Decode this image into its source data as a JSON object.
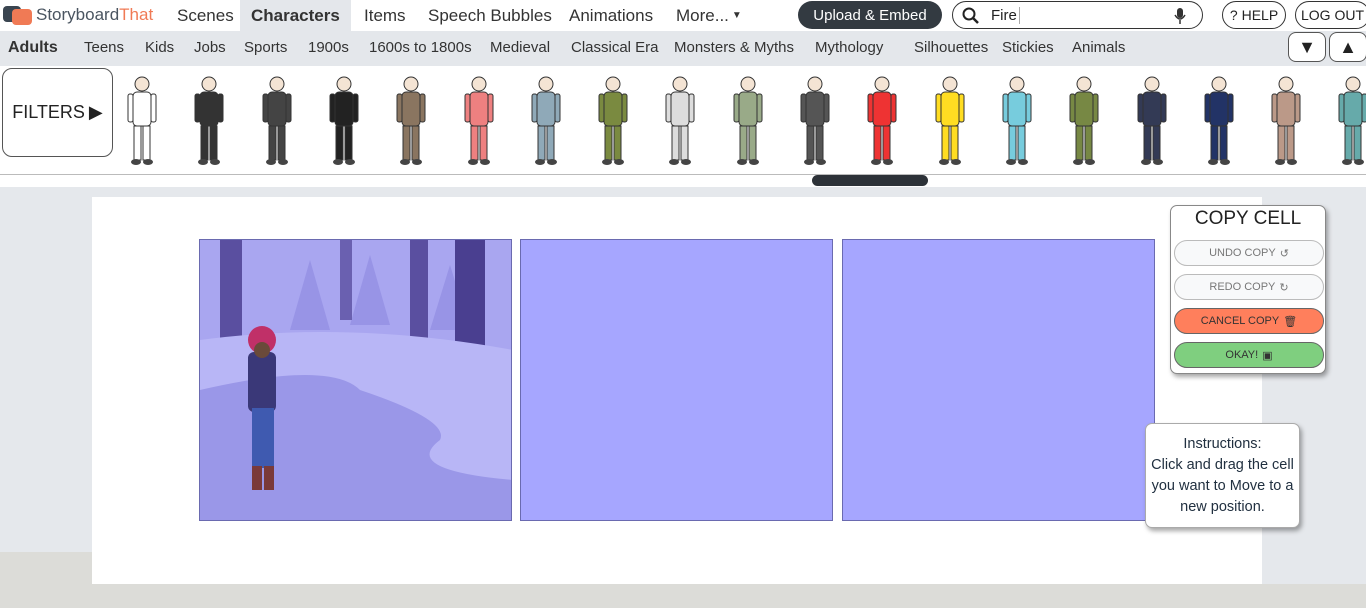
{
  "brand": {
    "name_part1": "Storyboard",
    "name_part2": "That"
  },
  "nav": {
    "items": [
      "Scenes",
      "Characters",
      "Items",
      "Speech Bubbles",
      "Animations",
      "More..."
    ],
    "active": "Characters"
  },
  "upload_label": "Upload & Embed",
  "search": {
    "value": "Fire"
  },
  "help_label": "HELP",
  "logout_label": "LOG OUT",
  "categories": [
    "Adults",
    "Teens",
    "Kids",
    "Jobs",
    "Sports",
    "1900s",
    "1600s to 1800s",
    "Medieval",
    "Classical Era",
    "Monsters & Myths",
    "Mythology",
    "Silhouettes",
    "Stickies",
    "Animals"
  ],
  "filters_label": "FILTERS",
  "character_colors": [
    "#ffffff",
    "#333333",
    "#444444",
    "#222222",
    "#8a7560",
    "#ee8080",
    "#8fa9b8",
    "#7a8a40",
    "#dddddd",
    "#99aa88",
    "#555555",
    "#ee3333",
    "#ffdd22",
    "#77ccdd",
    "#778844",
    "#333a55",
    "#223366",
    "#bb9988",
    "#66aaaa"
  ],
  "copy_cell": {
    "title": "COPY CELL",
    "undo": "UNDO COPY",
    "redo": "REDO COPY",
    "cancel": "CANCEL COPY",
    "okay": "OKAY!"
  },
  "instructions": {
    "title": "Instructions:",
    "text": "Click and drag the cell you want to Move to a new position."
  },
  "colors": {
    "cell": "#a6a6ff",
    "cancel": "#ff7f5c",
    "okay": "#7fcf7f",
    "accent": "#f07a55"
  }
}
